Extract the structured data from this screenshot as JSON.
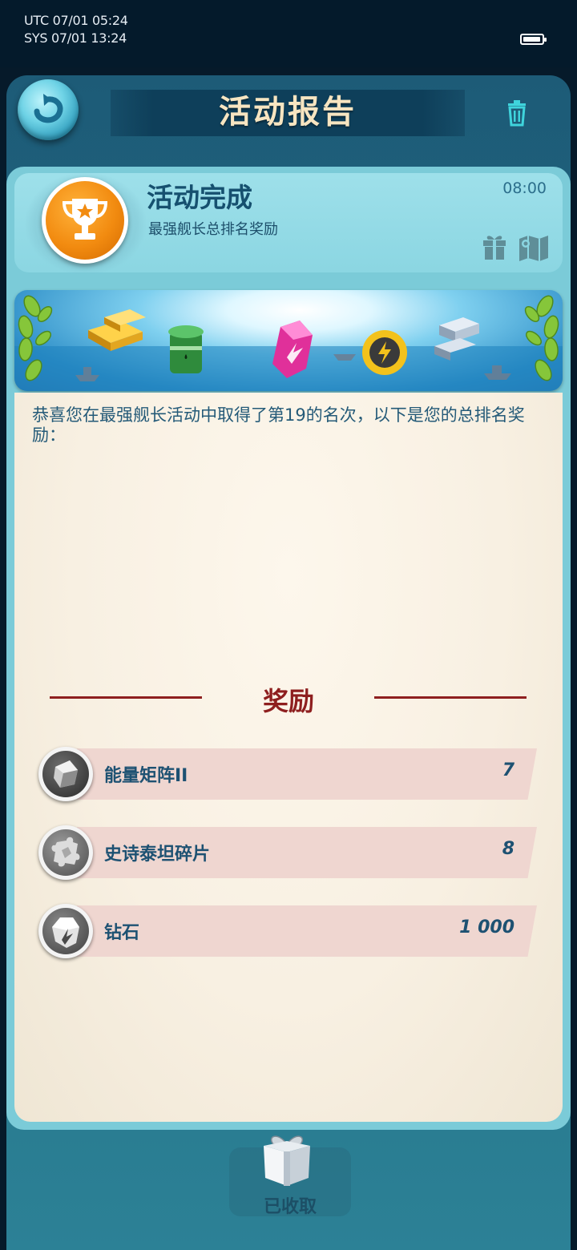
{
  "status_bar": {
    "utc": "UTC 07/01 05:24",
    "sys": "SYS 07/01 13:24",
    "battery_level": 0.95
  },
  "header": {
    "title": "活动报告"
  },
  "event": {
    "title": "活动完成",
    "subtitle": "最强舰长总排名奖励",
    "time": "08:00"
  },
  "message": "恭喜您在最强舰长活动中取得了第19的名次，以下是您的总排名奖励：",
  "rewards": {
    "title": "奖励",
    "items": [
      {
        "name": "能量矩阵II",
        "qty": "7",
        "icon": "energy-matrix-icon"
      },
      {
        "name": "史诗泰坦碎片",
        "qty": "8",
        "icon": "titan-shard-icon"
      },
      {
        "name": "钻石",
        "qty": "1 000",
        "icon": "diamond-icon"
      }
    ]
  },
  "footer": {
    "collected_label": "已收取"
  },
  "colors": {
    "accent_red": "#8e1f1f",
    "text_blue": "#1d5172",
    "title_cream": "#f7e5c1"
  }
}
